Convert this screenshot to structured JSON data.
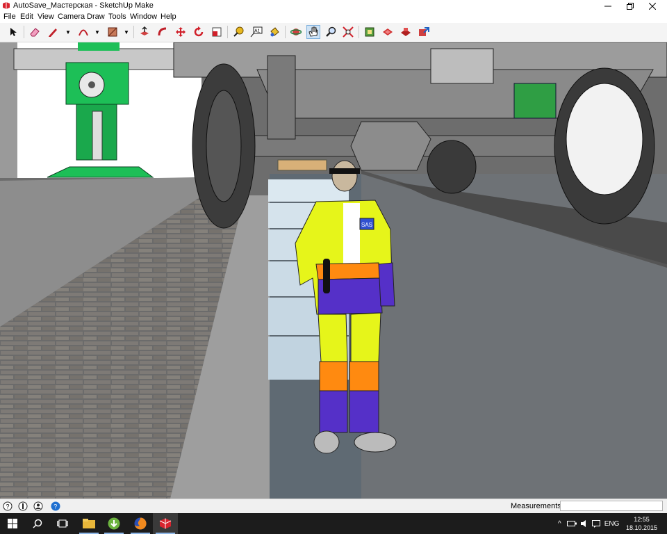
{
  "window": {
    "title": "AutoSave_Мастерская - SketchUp Make",
    "icons": {
      "app": "sketchup-icon",
      "minimize": "minimize-icon",
      "restore": "restore-icon",
      "close": "close-icon"
    }
  },
  "menu": [
    "File",
    "Edit",
    "View",
    "Camera",
    "Draw",
    "Tools",
    "Window",
    "Help"
  ],
  "toolbar": {
    "tools": [
      "select",
      "eraser",
      "pencil-line",
      "arc",
      "rectangle",
      "push-pull",
      "follow-me",
      "move",
      "rotate",
      "scale",
      "tape-measure",
      "text",
      "paint-bucket",
      "orbit",
      "pan",
      "zoom",
      "zoom-extents",
      "components",
      "warehouse",
      "extension-warehouse",
      "share-model"
    ],
    "active_tool": "pan"
  },
  "viewport": {
    "scene": "3D model: workshop with truck on lift and worker figure",
    "badge_text": "SAS",
    "colors": {
      "jacket": "#e6f51a",
      "stripe": "#ff8a10",
      "purple": "#5530c8",
      "lift": "#1dbf57",
      "floor": "#7a7a7a"
    }
  },
  "status": {
    "measurements_label": "Measurements",
    "measurements_value": ""
  },
  "taskbar": {
    "apps": [
      "start-icon",
      "search-icon",
      "task-view-icon",
      "file-explorer-icon",
      "torrent-icon",
      "firefox-icon",
      "sketchup-icon"
    ],
    "language": "ENG",
    "time": "12:55",
    "date": "18.10.2015"
  }
}
